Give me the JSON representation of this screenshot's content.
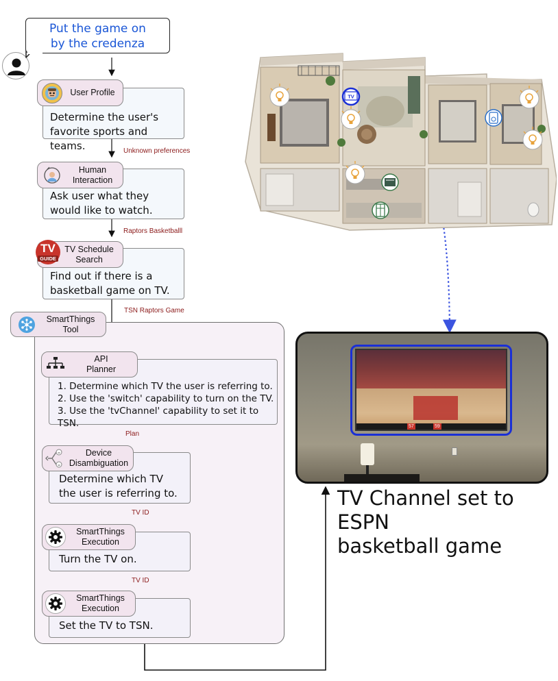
{
  "user_request": {
    "line1": "Put the game on",
    "line2": "by the credenza"
  },
  "steps": {
    "user_profile": {
      "tool": "User Profile",
      "description": "Determine the user's favorite sports and teams."
    },
    "human_interaction": {
      "tool_line1": "Human",
      "tool_line2": "Interaction",
      "description": "Ask user what they would like to watch."
    },
    "tv_schedule": {
      "tool_line1": "TV Schedule",
      "tool_line2": "Search",
      "logo_line1": "TV",
      "logo_line2": "GUIDE",
      "description": "Find out if there is a basketball game on TV."
    },
    "smartthings_tool": {
      "line1": "SmartThings",
      "line2": "Tool"
    },
    "api_planner": {
      "tool_line1": "API",
      "tool_line2": "Planner",
      "plan": [
        "1. Determine which TV the user is referring to.",
        "2. Use the 'switch' capability to turn on the TV.",
        "3. Use the 'tvChannel' capability to set it to TSN."
      ]
    },
    "device_disambiguation": {
      "tool_line1": "Device",
      "tool_line2": "Disambiguation",
      "description": "Determine which TV the user is referring to."
    },
    "execution_1": {
      "tool_line1": "SmartThings",
      "tool_line2": "Execution",
      "description": "Turn the TV on."
    },
    "execution_2": {
      "tool_line1": "SmartThings",
      "tool_line2": "Execution",
      "description": "Set the TV to TSN."
    }
  },
  "edge_labels": {
    "profile_to_human": "Unknown preferences",
    "human_to_schedule": "Raptors Basketballl",
    "schedule_to_tool": "TSN Raptors Game",
    "planner_to_disambig": "Plan",
    "disambig_to_exec1": "TV ID",
    "exec1_to_exec2": "TV ID"
  },
  "floorplan": {
    "tv_marker": "TV"
  },
  "tv_photo": {
    "score_left": "57",
    "score_right": "59"
  },
  "result_caption": {
    "line1": "TV Channel set to ESPN",
    "line2": "basketball game"
  },
  "colors": {
    "request_text": "#1a56d6",
    "edge_label": "#8b1a1a",
    "dotted_link": "#3b54e0",
    "tv_highlight": "#1a2fd6"
  },
  "icons": [
    "user-avatar-icon",
    "robot-face-icon",
    "human-interaction-icon",
    "tv-guide-logo",
    "smartthings-network-icon",
    "hierarchy-icon",
    "disambiguation-icon",
    "gear-icon",
    "light-bulb-icon",
    "fridge-icon",
    "oven-icon",
    "speaker-icon"
  ]
}
